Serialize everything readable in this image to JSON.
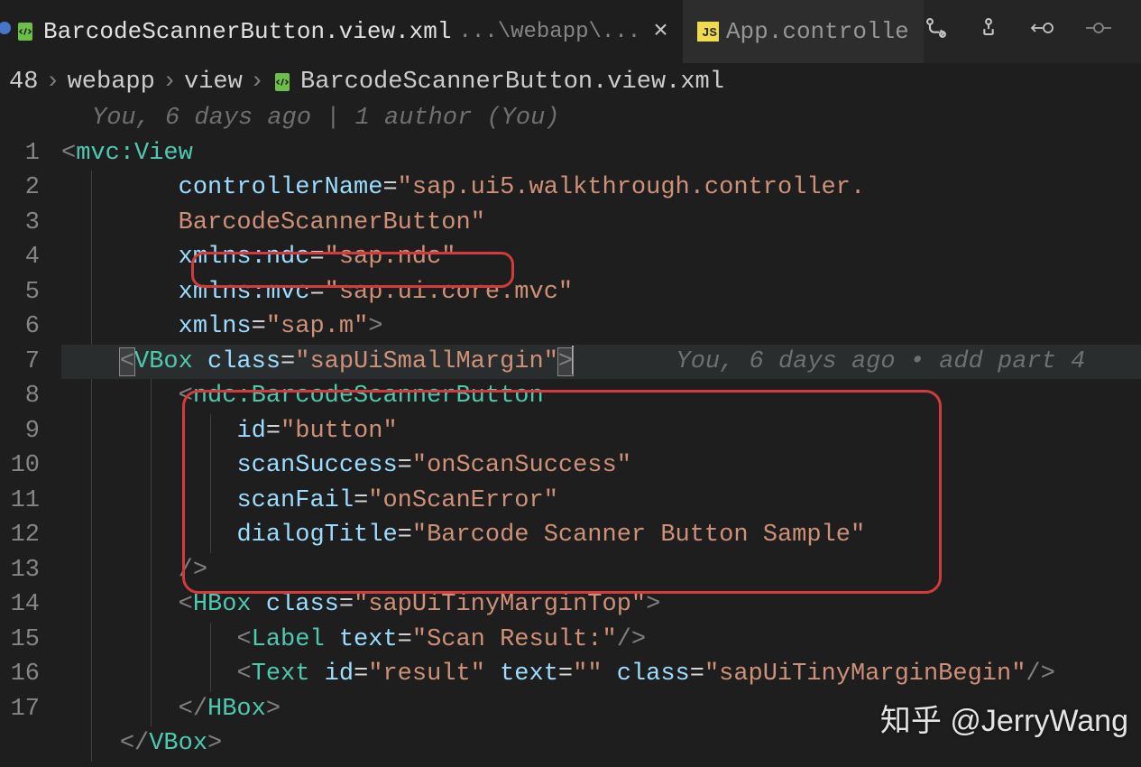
{
  "tabs": {
    "active": {
      "title": "BarcodeScannerButton.view.xml",
      "subtitle": "...\\webapp\\..."
    },
    "inactive": {
      "title": "App.controlle"
    }
  },
  "breadcrumb": {
    "partial": "48",
    "seg1": "webapp",
    "seg2": "view",
    "seg3": "BarcodeScannerButton.view.xml"
  },
  "blame": {
    "top": "You, 6 days ago | 1 author (You)",
    "inline": "You, 6 days ago • add part 4"
  },
  "gutter": [
    "1",
    "2",
    "3",
    "4",
    "5",
    "6",
    "7",
    "8",
    "9",
    "10",
    "11",
    "12",
    "13",
    "14",
    "15",
    "16",
    "17"
  ],
  "code": {
    "l1_tag": "mvc:View",
    "l2_attr": "controllerName",
    "l2_val_a": "sap.ui5.walkthrough.controller.",
    "l2_val_b": "BarcodeScannerButton",
    "l3_attr": "xmlns:ndc",
    "l3_val": "sap.ndc",
    "l4_attr": "xmlns:mvc",
    "l4_val": "sap.ui.core.mvc",
    "l5_attr": "xmlns",
    "l5_val": "sap.m",
    "l6_tag": "VBox",
    "l6_attr": "class",
    "l6_val": "sapUiSmallMargin",
    "l7_tag": "ndc:BarcodeScannerButton",
    "l8_attr": "id",
    "l8_val": "button",
    "l9_attr": "scanSuccess",
    "l9_val": "onScanSuccess",
    "l10_attr": "scanFail",
    "l10_val": "onScanError",
    "l11_attr": "dialogTitle",
    "l11_val": "Barcode Scanner Button Sample",
    "l13_tag": "HBox",
    "l13_attr": "class",
    "l13_val": "sapUiTinyMarginTop",
    "l14_tag": "Label",
    "l14_attr": "text",
    "l14_val": "Scan Result:",
    "l15_tag": "Text",
    "l15_attr1": "id",
    "l15_val1": "result",
    "l15_attr2": "text",
    "l15_val2": "",
    "l15_attr3": "class",
    "l15_val3": "sapUiTinyMarginBegin",
    "l16_close": "HBox",
    "l17_close": "VBox"
  },
  "watermark": "知乎 @JerryWang"
}
